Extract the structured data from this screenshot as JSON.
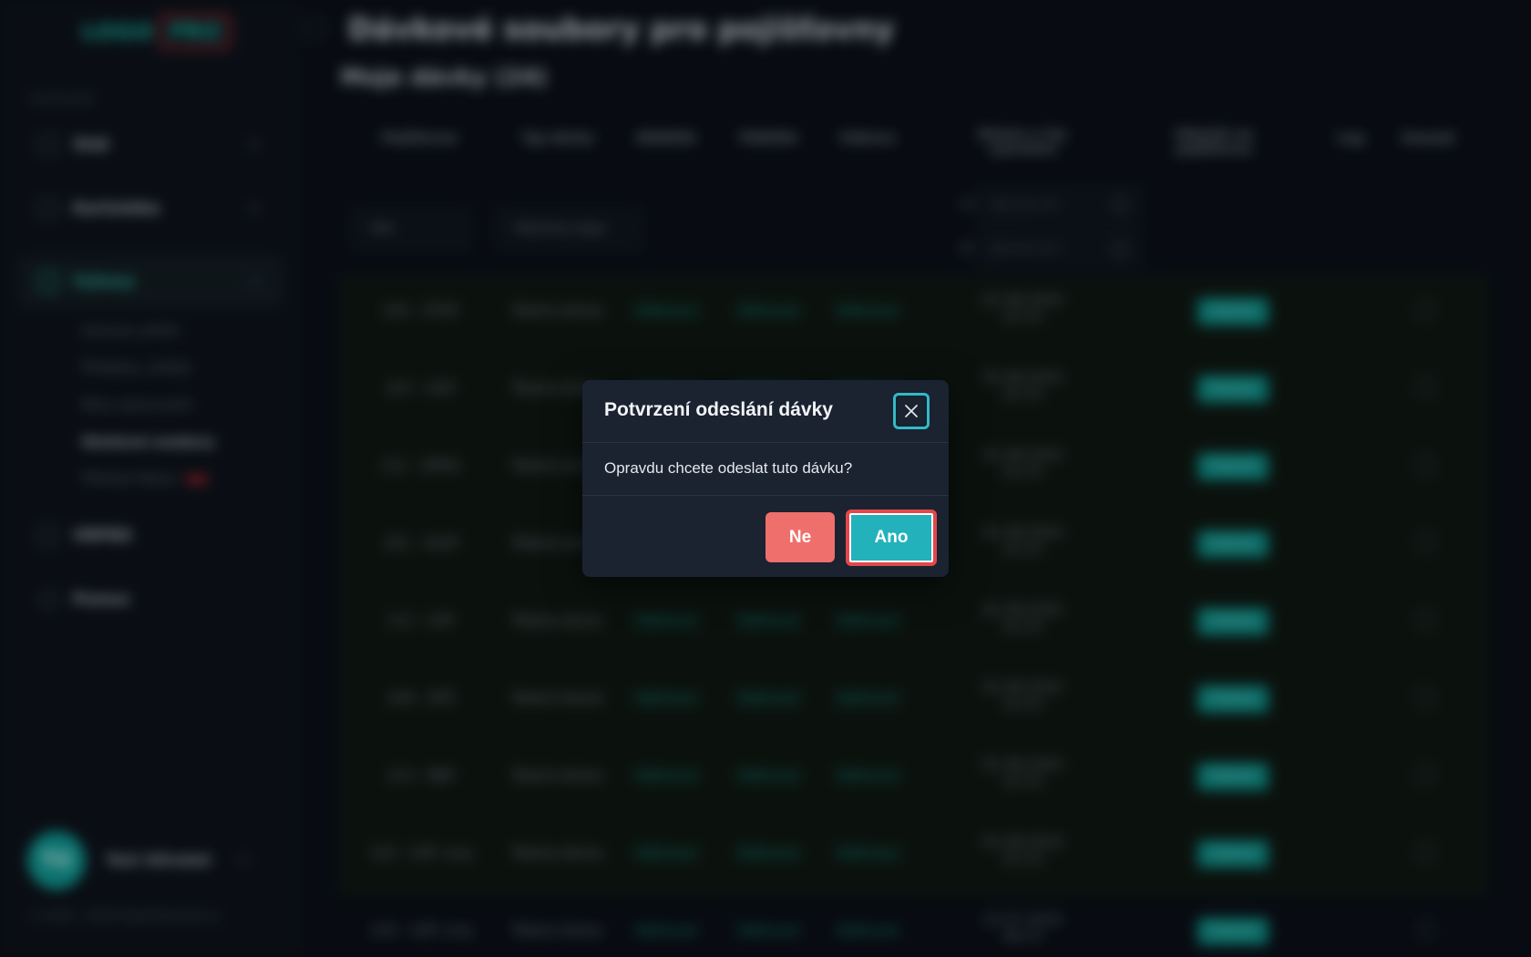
{
  "app": {
    "logo": {
      "word": "LOGO",
      "badge": "PRO"
    },
    "section_label": "OVERVIEW",
    "nav": [
      {
        "label": "Stát",
        "icon": "box-icon"
      },
      {
        "label": "Kartotéka",
        "icon": "folder-icon"
      },
      {
        "label": "Vykazy",
        "icon": "chart-icon"
      },
      {
        "label": "VRPNS",
        "icon": "list-icon"
      },
      {
        "label": "Pomoc",
        "icon": "help-icon"
      }
    ],
    "subnav": [
      "Seznam příloh",
      "Předpisy, platby",
      "Boty zpracování",
      "Dávkové soubory",
      "Přehled faktur"
    ],
    "user": {
      "initials": "TU",
      "name": "Test Uživatel"
    },
    "footer": "© 2023 - 2024 Zaplatitelnost.cz"
  },
  "page": {
    "title": "Dávkové soubory pro pojišťovny",
    "subtitle": "Moje dávky (24)"
  },
  "table": {
    "headers": [
      "Pojišťovna",
      "Typ dávky",
      "KDÁVKA",
      "FDÁVKA",
      "Faktura",
      "Datum a čas vytvoření",
      "Odeslat na pojišťovnu",
      "Log",
      "Smazat"
    ],
    "filters": {
      "insurer": "Vše",
      "type": "Všechny typy",
      "date_from_label": "od",
      "date_to_label": "do",
      "date_placeholder": "dd.mm.rrrr"
    },
    "rows": [
      {
        "insurer": "205 - ČPZP",
        "type": "Řádná dávka",
        "kdavka": "Stáhnout",
        "fdavka": "Stáhnout",
        "faktura": "Stáhnout",
        "date": "01.08.2024",
        "time": "22:13",
        "send": "Odeslat"
      },
      {
        "insurer": "207 - OZP",
        "type": "Řádná dávka",
        "kdavka": "Stáhnout",
        "fdavka": "Stáhnout",
        "faktura": "Stáhnout",
        "date": "01.08.2024",
        "time": "22:13",
        "send": "Odeslat"
      },
      {
        "insurer": "211 - ZPMV",
        "type": "Řádná dávka",
        "kdavka": "Stáhnout",
        "fdavka": "Stáhnout",
        "faktura": "Stáhnout",
        "date": "01.08.2024",
        "time": "22:13",
        "send": "Odeslat"
      },
      {
        "insurer": "201 - VoZP",
        "type": "Řádná dávka",
        "kdavka": "Stáhnout",
        "fdavka": "Stáhnout",
        "faktura": "Stáhnout",
        "date": "01.08.2024",
        "time": "22:13",
        "send": "Odeslat"
      },
      {
        "insurer": "111 - VZP",
        "type": "Řádná dávka",
        "kdavka": "Stáhnout",
        "fdavka": "Stáhnout",
        "faktura": "Stáhnout",
        "date": "01.08.2024",
        "time": "22:13",
        "send": "Odeslat"
      },
      {
        "insurer": "209 - ZPŠ",
        "type": "Řádná dávka",
        "kdavka": "Stáhnout",
        "fdavka": "Stáhnout",
        "faktura": "Stáhnout",
        "date": "01.08.2024",
        "time": "22:13",
        "send": "Odeslat"
      },
      {
        "insurer": "213 - RBP",
        "type": "Řádná dávka",
        "kdavka": "Stáhnout",
        "fdavka": "Stáhnout",
        "faktura": "Stáhnout",
        "date": "01.08.2024",
        "time": "22:13",
        "send": "Odeslat"
      },
      {
        "insurer": "333 - VZP, kraj",
        "type": "Řádná dávka",
        "kdavka": "Stáhnout",
        "fdavka": "Stáhnout",
        "faktura": "Stáhnout",
        "date": "01.08.2024",
        "time": "22:13",
        "send": "Odeslat"
      },
      {
        "insurer": "333 - VZP, kraj",
        "type": "Řádná dávka",
        "kdavka": "Stáhnout",
        "fdavka": "Stáhnout",
        "faktura": "Stáhnout",
        "date": "23.07.2024",
        "time": "08:13",
        "send": "Odeslat"
      }
    ]
  },
  "modal": {
    "title": "Potvrzení odeslání dávky",
    "body": "Opravdu chcete odeslat tuto dávku?",
    "no_label": "Ne",
    "yes_label": "Ano"
  },
  "colors": {
    "accent": "#23b2bb",
    "danger": "#ef6f6c",
    "highlight": "#e2474b",
    "modal_bg": "#1b2230"
  }
}
